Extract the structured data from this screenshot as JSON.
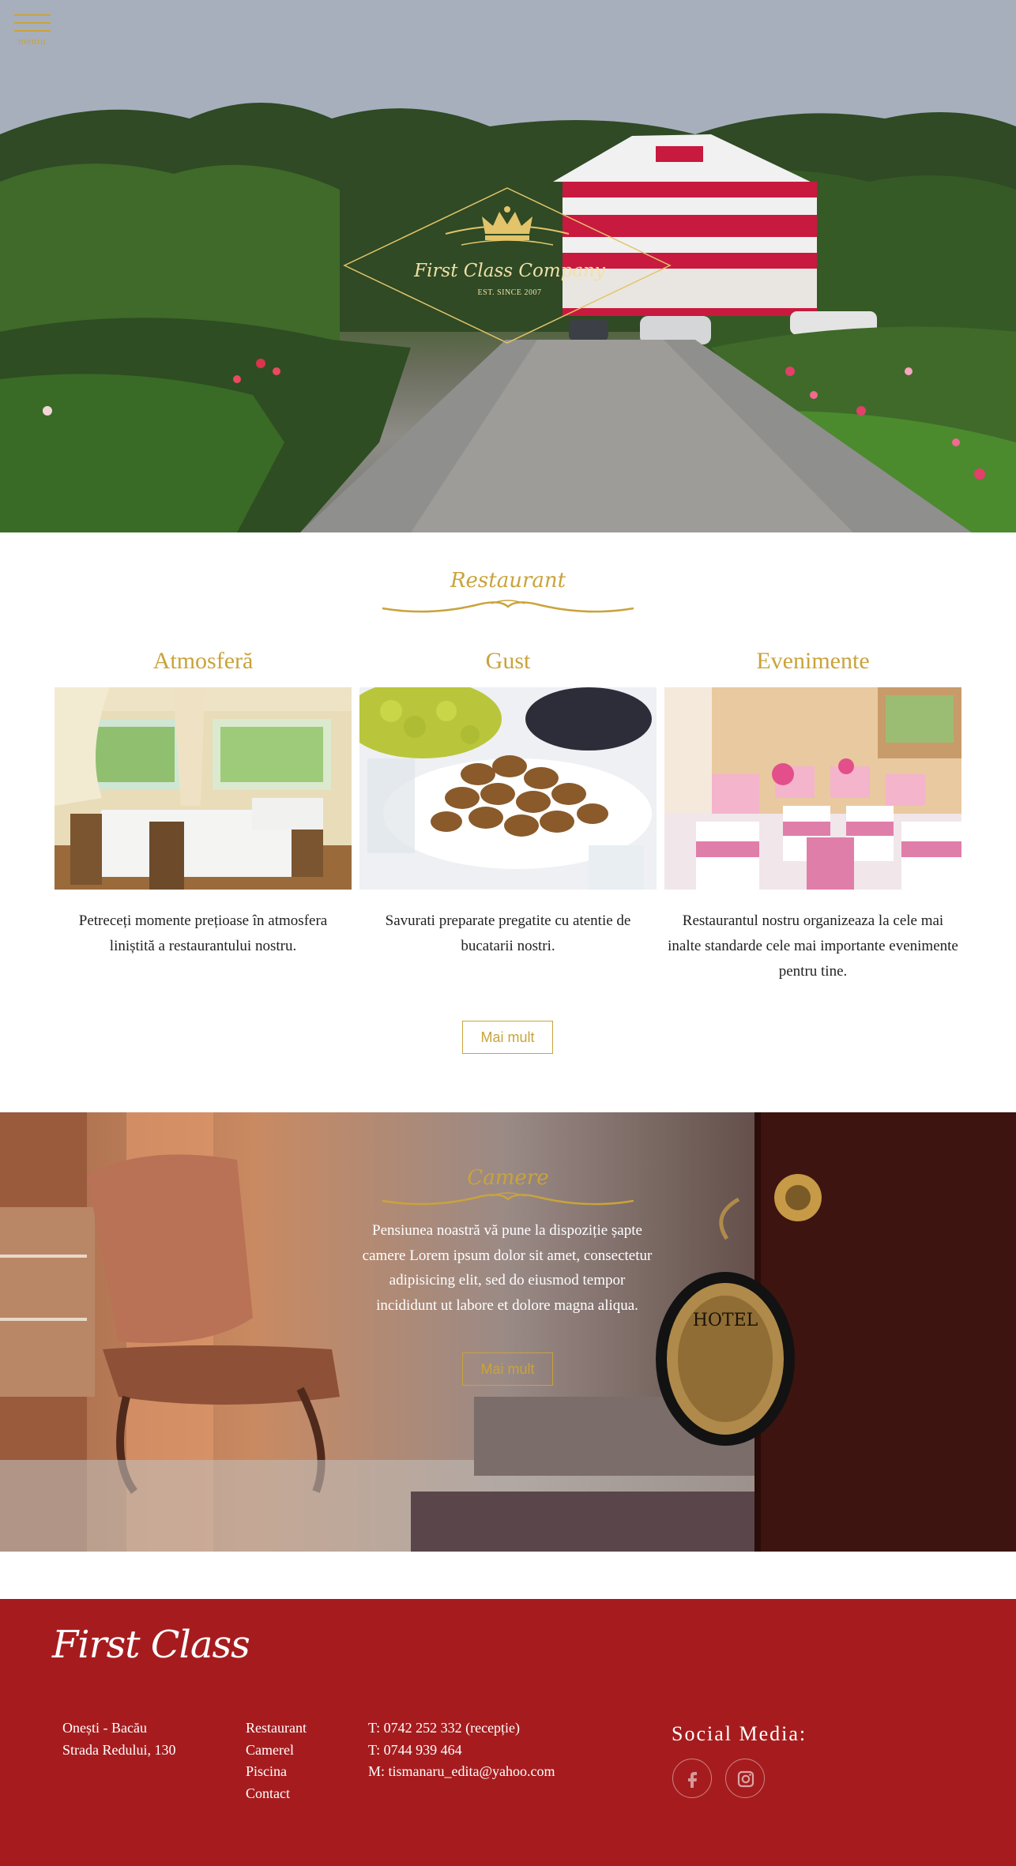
{
  "header": {
    "menu_label": "meniu",
    "logo_title": "First Class Company",
    "logo_subtitle": "EST. SINCE 2007"
  },
  "restaurant": {
    "title": "Restaurant",
    "columns": [
      {
        "heading": "Atmosferă",
        "text": "Petreceți momente prețioase în atmosfera liniștită a restaurantului nostru."
      },
      {
        "heading": "Gust",
        "text": "Savurati preparate pregatite cu atentie de bucatarii nostri."
      },
      {
        "heading": "Evenimente",
        "text": "Restaurantul nostru organizeaza la cele mai inalte standarde cele mai importante evenimente pentru tine."
      }
    ],
    "button_label": "Mai mult"
  },
  "camere": {
    "title": "Camere",
    "text": "Pensiunea noastră vă pune la dispoziție șapte camere Lorem ipsum dolor sit amet, consectetur adipisicing elit, sed do eiusmod tempor incididunt ut labore et dolore magna aliqua.",
    "button_label": "Mai mult"
  },
  "footer": {
    "brand": "First Class",
    "address": [
      "Onești - Bacău",
      "Strada Redului, 130"
    ],
    "nav": [
      "Restaurant",
      "Camerel",
      "Piscina",
      "Contact"
    ],
    "contact": [
      "T: 0742 252 332 (recepție)",
      "T: 0744 939 464",
      "M: tismanaru_edita@yahoo.com"
    ],
    "social_title": "Social Media:",
    "social_icons": [
      "facebook-icon",
      "instagram-icon"
    ]
  },
  "colors": {
    "gold": "#c9a33b",
    "footer_red": "#a61c1e",
    "house_red": "#c8193f"
  }
}
